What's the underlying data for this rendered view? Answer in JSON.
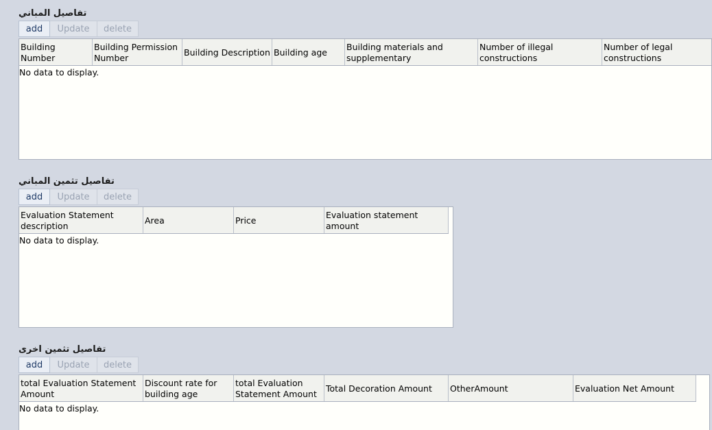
{
  "toolbar": {
    "add": "add",
    "update": "Update",
    "delete": "delete"
  },
  "empty_text": "No data to display.",
  "sections": [
    {
      "title": "تفاصيل المباني",
      "columns": [
        "Building Number",
        "Building Permission Number",
        "Building Description",
        "Building age",
        "Building materials and supplementary",
        "Number of illegal constructions",
        "Number of legal constructions"
      ]
    },
    {
      "title": "تفاصيل تثمين المباني",
      "columns": [
        "Evaluation Statement description",
        "Area",
        "Price",
        "Evaluation statement amount"
      ]
    },
    {
      "title": "تفاصيل تثمين اخرى",
      "columns": [
        "total Evaluation Statement Amount",
        "Discount rate for building age",
        "total Evaluation Statement Amount",
        "Total Decoration Amount",
        "OtherAmount",
        "Evaluation Net Amount"
      ]
    }
  ]
}
